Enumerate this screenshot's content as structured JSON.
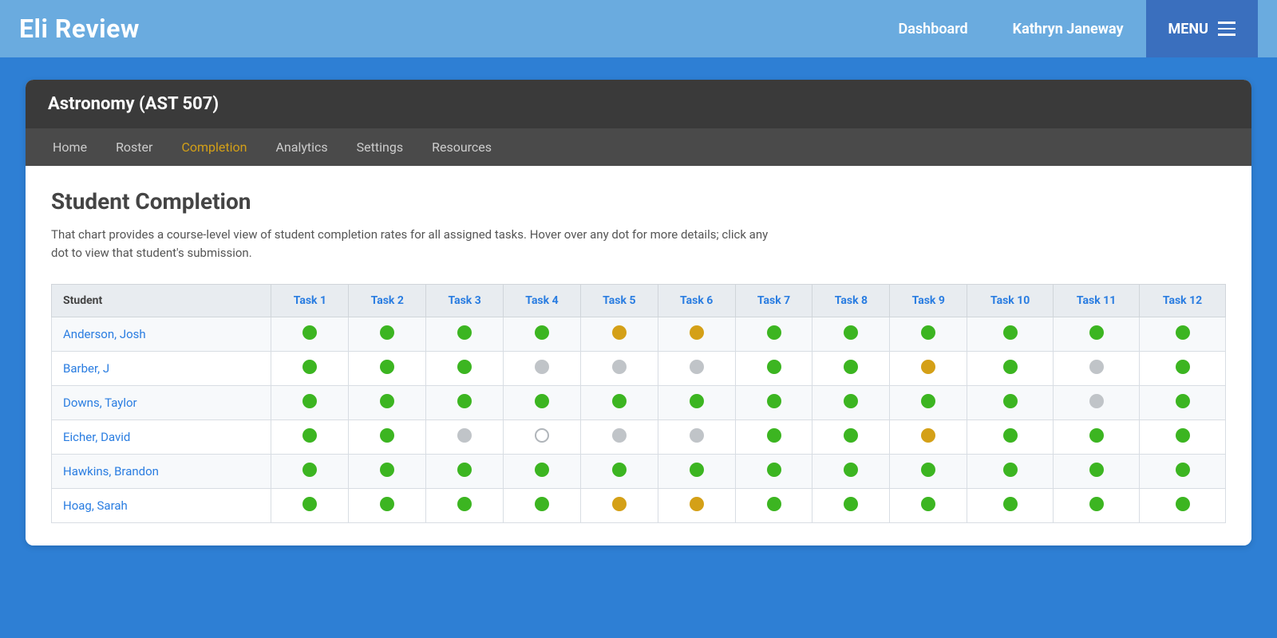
{
  "header": {
    "logo": "Eli Review",
    "dashboard_label": "Dashboard",
    "user_label": "Kathryn Janeway",
    "menu_label": "MENU"
  },
  "course": {
    "title": "Astronomy (AST 507)",
    "nav_tabs": [
      {
        "id": "home",
        "label": "Home",
        "active": false
      },
      {
        "id": "roster",
        "label": "Roster",
        "active": false
      },
      {
        "id": "completion",
        "label": "Completion",
        "active": true
      },
      {
        "id": "analytics",
        "label": "Analytics",
        "active": false
      },
      {
        "id": "settings",
        "label": "Settings",
        "active": false
      },
      {
        "id": "resources",
        "label": "Resources",
        "active": false
      }
    ]
  },
  "completion": {
    "section_title": "Student Completion",
    "description": "That chart provides a course-level view of student completion rates for all assigned tasks. Hover over any dot for more details; click any dot to view that student's submission.",
    "table": {
      "headers": [
        "Student",
        "Task 1",
        "Task 2",
        "Task 3",
        "Task 4",
        "Task 5",
        "Task 6",
        "Task 7",
        "Task 8",
        "Task 9",
        "Task 10",
        "Task 11",
        "Task 12"
      ],
      "rows": [
        {
          "name": "Anderson, Josh",
          "tasks": [
            "green",
            "green",
            "green",
            "green",
            "yellow",
            "yellow",
            "green",
            "green",
            "green",
            "green",
            "green",
            "green"
          ]
        },
        {
          "name": "Barber, J",
          "tasks": [
            "green",
            "green",
            "green",
            "gray",
            "gray",
            "gray",
            "green",
            "green",
            "yellow",
            "green",
            "gray",
            "green"
          ]
        },
        {
          "name": "Downs, Taylor",
          "tasks": [
            "green",
            "green",
            "green",
            "green",
            "green",
            "green",
            "green",
            "green",
            "green",
            "green",
            "gray",
            "green"
          ]
        },
        {
          "name": "Eicher, David",
          "tasks": [
            "green",
            "green",
            "gray",
            "empty",
            "gray",
            "gray",
            "green",
            "green",
            "yellow",
            "green",
            "green",
            "green"
          ]
        },
        {
          "name": "Hawkins, Brandon",
          "tasks": [
            "green",
            "green",
            "green",
            "green",
            "green",
            "green",
            "green",
            "green",
            "green",
            "green",
            "green",
            "green"
          ]
        },
        {
          "name": "Hoag, Sarah",
          "tasks": [
            "green",
            "green",
            "green",
            "green",
            "yellow",
            "yellow",
            "green",
            "green",
            "green",
            "green",
            "green",
            "green"
          ]
        }
      ]
    }
  }
}
